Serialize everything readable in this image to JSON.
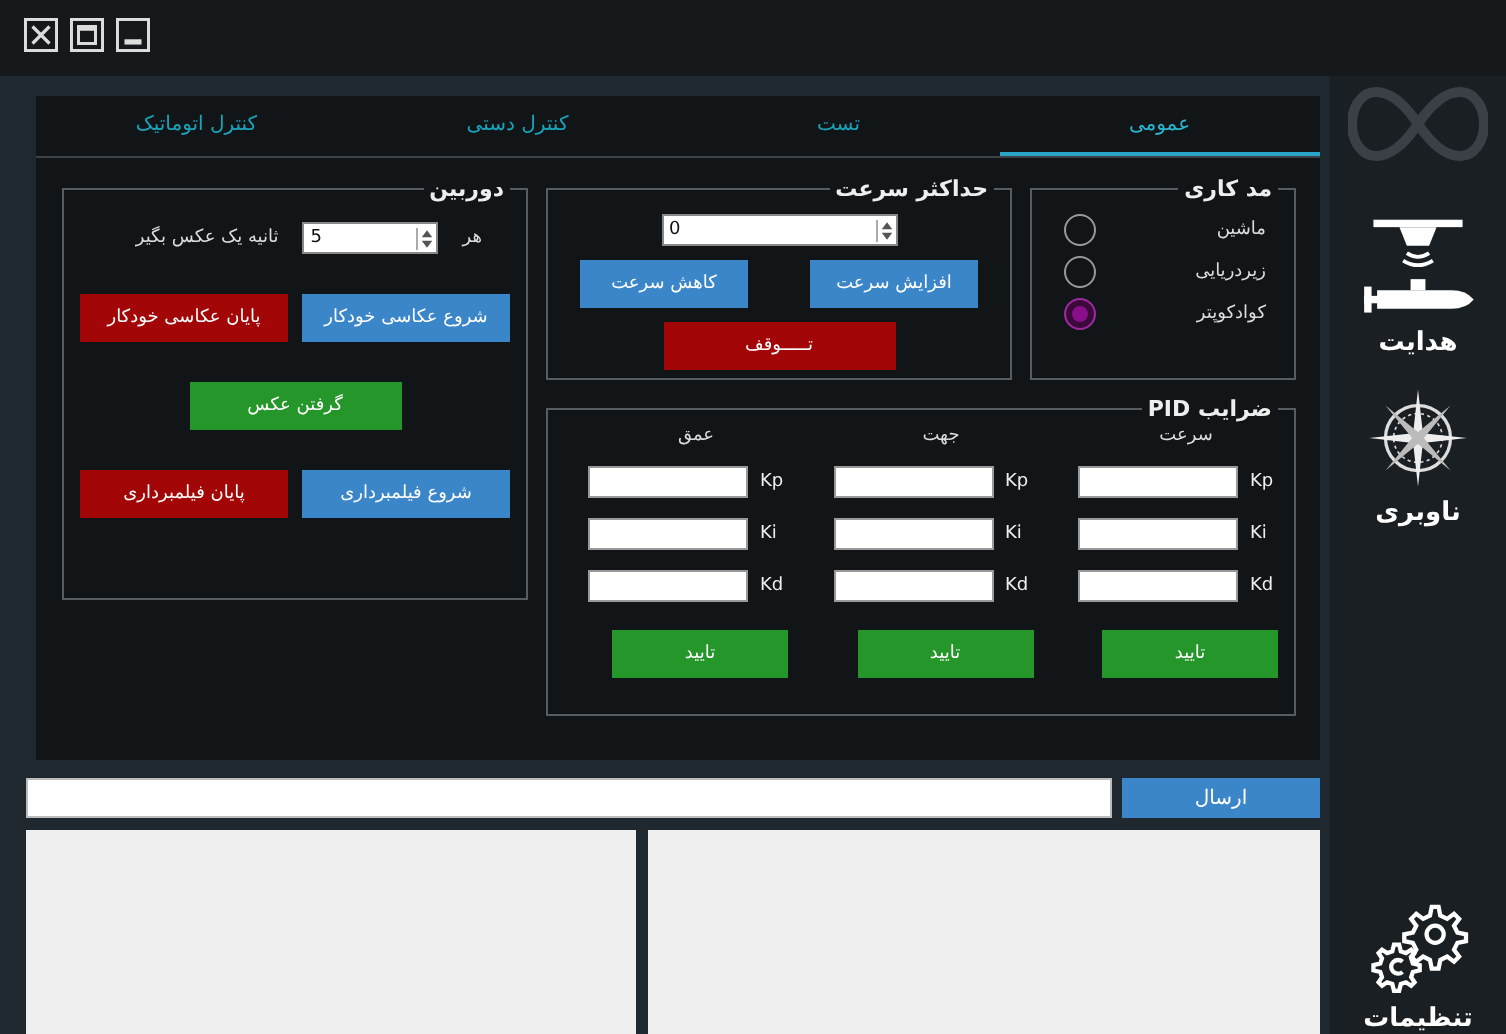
{
  "tabs": [
    {
      "label": "عمومی",
      "selected": true
    },
    {
      "label": "تست",
      "selected": false
    },
    {
      "label": "کنترل دستی",
      "selected": false
    },
    {
      "label": "کنترل اتوماتیک",
      "selected": false
    }
  ],
  "mode_group": {
    "title": "مد کاری",
    "options": [
      {
        "label": "ماشین",
        "selected": false
      },
      {
        "label": "زیردریایی",
        "selected": false
      },
      {
        "label": "کوادکوپتر",
        "selected": true
      }
    ]
  },
  "speed_group": {
    "title": "حداکثر سرعت",
    "value": "0",
    "buttons": [
      {
        "label": "افزایش سرعت",
        "kind": "primary"
      },
      {
        "label": "کاهش سرعت",
        "kind": "primary"
      },
      {
        "label": "تـــــوقف",
        "kind": "danger"
      }
    ]
  },
  "camera_group": {
    "title": "دوربین",
    "interval_prefix": "هر",
    "interval_value": "5",
    "interval_suffix": "ثانیه یک عکس بگیر",
    "buttons": [
      {
        "label": "شروع عکاسی خودکار",
        "kind": "primary"
      },
      {
        "label": "پایان عکاسی خودکار",
        "kind": "danger"
      },
      {
        "label": "گرفتن عکس",
        "kind": "success"
      },
      {
        "label": "شروع فیلمبرداری",
        "kind": "primary"
      },
      {
        "label": "پایان فیلمبرداری",
        "kind": "danger"
      }
    ]
  },
  "pid_group": {
    "title": "ضرایب PID",
    "columns": [
      {
        "heading": "سرعت",
        "gains": [
          "Kp",
          "Ki",
          "Kd"
        ],
        "confirm": "تایید"
      },
      {
        "heading": "جهت",
        "gains": [
          "Kp",
          "Ki",
          "Kd"
        ],
        "confirm": "تایید"
      },
      {
        "heading": "عمق",
        "gains": [
          "Kp",
          "Ki",
          "Kd"
        ],
        "confirm": "تایید"
      }
    ]
  },
  "command": {
    "send": "ارسال"
  },
  "sidebar": {
    "items": [
      {
        "label": "هدایت",
        "kind": "drone"
      },
      {
        "label": "ناوبری",
        "kind": "compass"
      },
      {
        "label": "تنظیمات",
        "kind": "settings"
      }
    ]
  }
}
